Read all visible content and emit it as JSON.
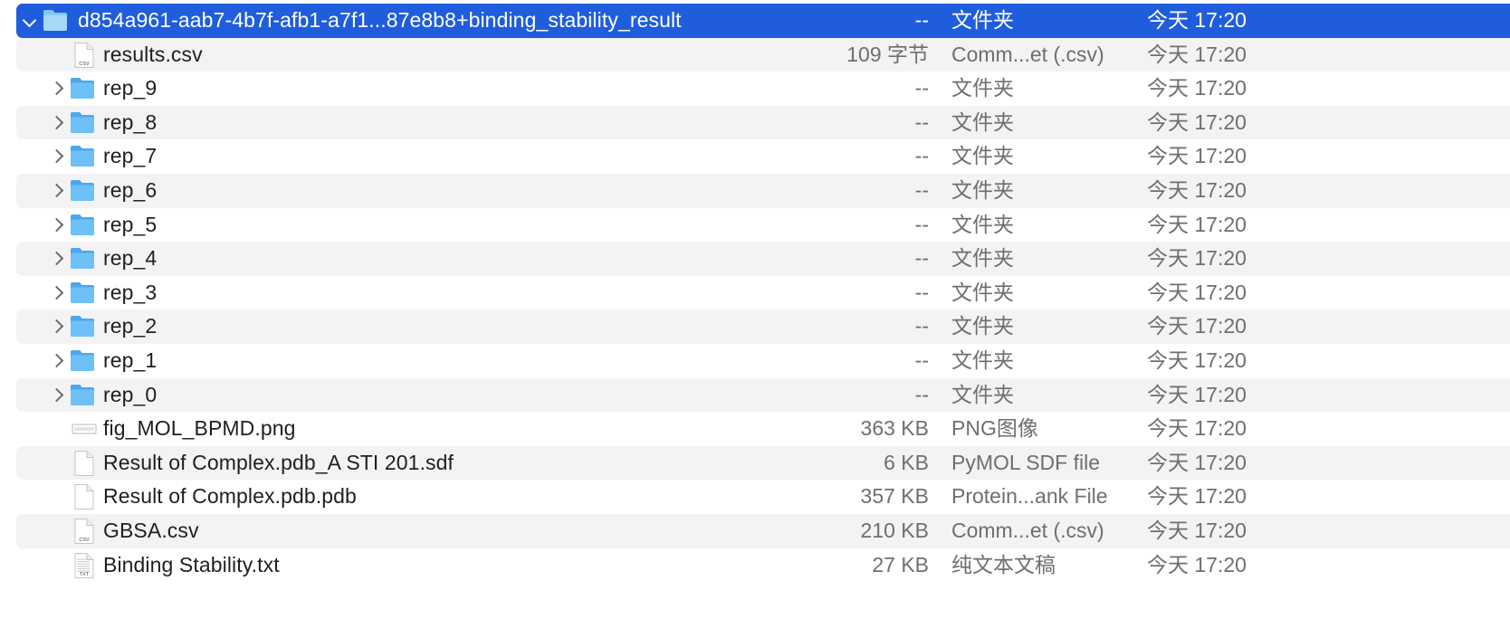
{
  "items": [
    {
      "name": "d854a961-aab7-4b7f-afb1-a7f1...87e8b8+binding_stability_result",
      "size": "--",
      "kind": "文件夹",
      "date": "今天 17:20",
      "type": "folder",
      "expanded": true,
      "selected": true,
      "indent": 0
    },
    {
      "name": "results.csv",
      "size": "109 字节",
      "kind": "Comm...et (.csv)",
      "date": "今天 17:20",
      "type": "csv",
      "indent": 1
    },
    {
      "name": "rep_9",
      "size": "--",
      "kind": "文件夹",
      "date": "今天 17:20",
      "type": "folder",
      "indent": 1
    },
    {
      "name": "rep_8",
      "size": "--",
      "kind": "文件夹",
      "date": "今天 17:20",
      "type": "folder",
      "indent": 1
    },
    {
      "name": "rep_7",
      "size": "--",
      "kind": "文件夹",
      "date": "今天 17:20",
      "type": "folder",
      "indent": 1
    },
    {
      "name": "rep_6",
      "size": "--",
      "kind": "文件夹",
      "date": "今天 17:20",
      "type": "folder",
      "indent": 1
    },
    {
      "name": "rep_5",
      "size": "--",
      "kind": "文件夹",
      "date": "今天 17:20",
      "type": "folder",
      "indent": 1
    },
    {
      "name": "rep_4",
      "size": "--",
      "kind": "文件夹",
      "date": "今天 17:20",
      "type": "folder",
      "indent": 1
    },
    {
      "name": "rep_3",
      "size": "--",
      "kind": "文件夹",
      "date": "今天 17:20",
      "type": "folder",
      "indent": 1
    },
    {
      "name": "rep_2",
      "size": "--",
      "kind": "文件夹",
      "date": "今天 17:20",
      "type": "folder",
      "indent": 1
    },
    {
      "name": "rep_1",
      "size": "--",
      "kind": "文件夹",
      "date": "今天 17:20",
      "type": "folder",
      "indent": 1
    },
    {
      "name": "rep_0",
      "size": "--",
      "kind": "文件夹",
      "date": "今天 17:20",
      "type": "folder",
      "indent": 1
    },
    {
      "name": "fig_MOL_BPMD.png",
      "size": "363 KB",
      "kind": "PNG图像",
      "date": "今天 17:20",
      "type": "png",
      "indent": 1
    },
    {
      "name": "Result of Complex.pdb_A STI 201.sdf",
      "size": "6 KB",
      "kind": "PyMOL SDF file",
      "date": "今天 17:20",
      "type": "doc",
      "indent": 1
    },
    {
      "name": "Result of Complex.pdb.pdb",
      "size": "357 KB",
      "kind": "Protein...ank File",
      "date": "今天 17:20",
      "type": "doc",
      "indent": 1
    },
    {
      "name": "GBSA.csv",
      "size": "210 KB",
      "kind": "Comm...et (.csv)",
      "date": "今天 17:20",
      "type": "csv",
      "indent": 1
    },
    {
      "name": "Binding Stability.txt",
      "size": "27 KB",
      "kind": "纯文本文稿",
      "date": "今天 17:20",
      "type": "txt",
      "indent": 1
    }
  ],
  "icon_labels": {
    "csv": "CSV",
    "txt": "TXT"
  },
  "colors": {
    "selection": "#1f5ddc",
    "folder": "#5cb8f2",
    "alt_row": "#f3f3f4"
  }
}
